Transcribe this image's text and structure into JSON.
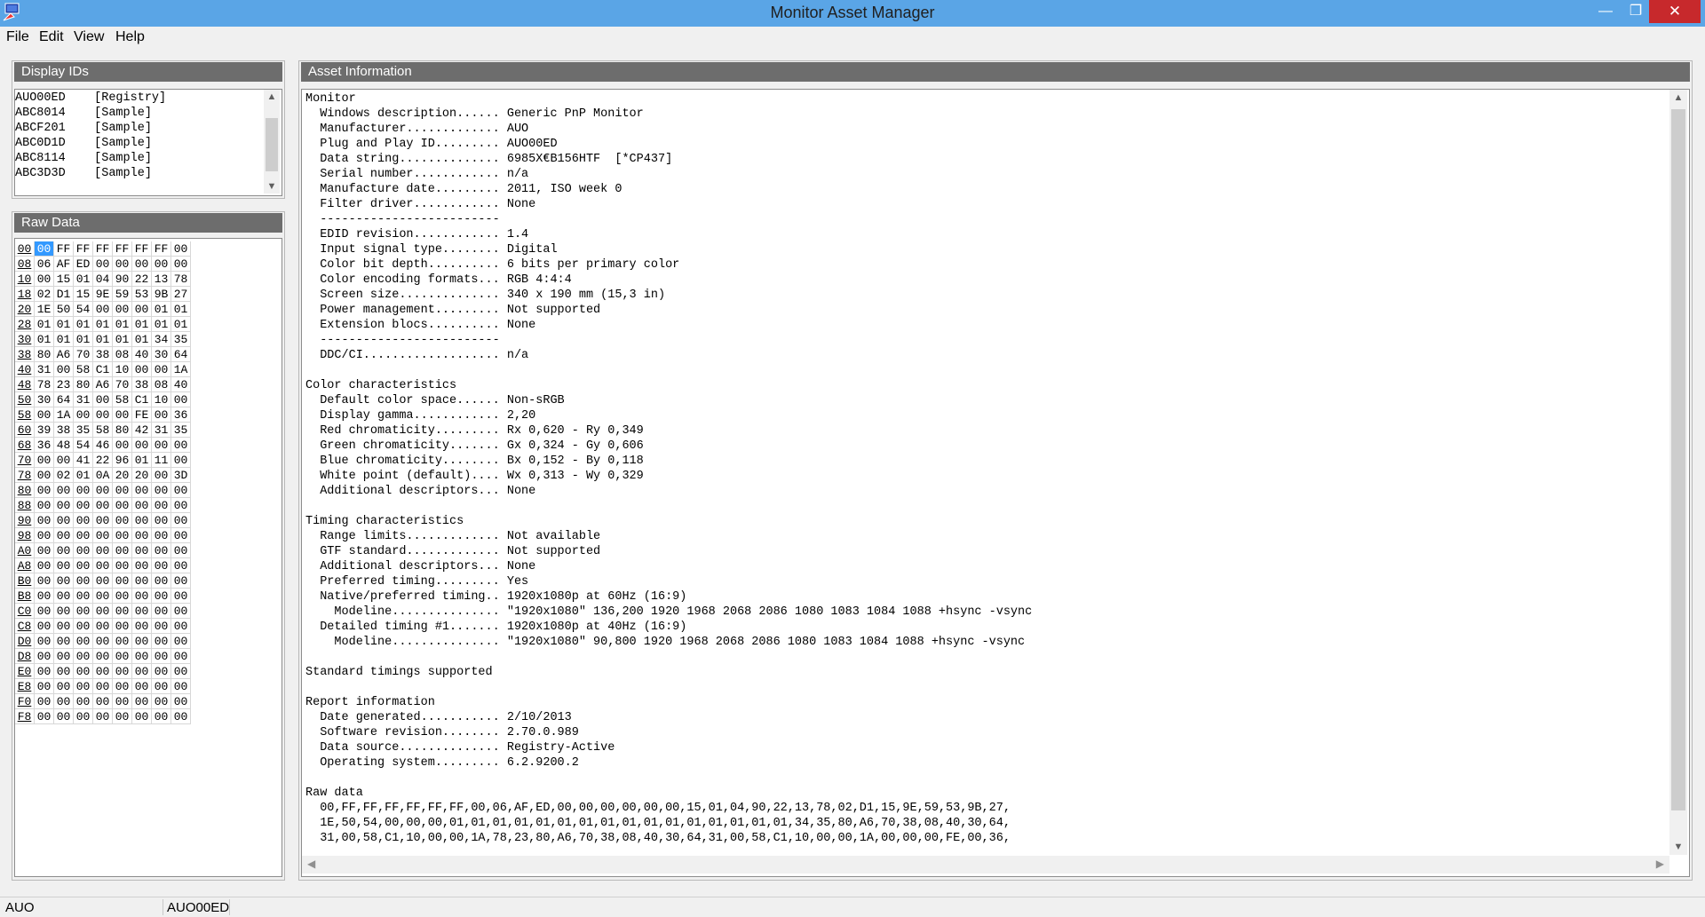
{
  "window": {
    "title": "Monitor Asset Manager",
    "minimize": "—",
    "maximize": "❐",
    "close": "✕"
  },
  "menu": [
    "File",
    "Edit",
    "View",
    "Help"
  ],
  "display_ids": {
    "header": "Display IDs",
    "items": [
      "AUO00ED    [Registry]",
      "ABC8014    [Sample]",
      "ABCF201    [Sample]",
      "ABC0D1D    [Sample]",
      "ABC8114    [Sample]",
      "ABC3D3D    [Sample]"
    ]
  },
  "raw_data": {
    "header": "Raw Data",
    "rows": [
      [
        "00",
        "00",
        "FF",
        "FF",
        "FF",
        "FF",
        "FF",
        "FF",
        "00"
      ],
      [
        "08",
        "06",
        "AF",
        "ED",
        "00",
        "00",
        "00",
        "00",
        "00"
      ],
      [
        "10",
        "00",
        "15",
        "01",
        "04",
        "90",
        "22",
        "13",
        "78"
      ],
      [
        "18",
        "02",
        "D1",
        "15",
        "9E",
        "59",
        "53",
        "9B",
        "27"
      ],
      [
        "20",
        "1E",
        "50",
        "54",
        "00",
        "00",
        "00",
        "01",
        "01"
      ],
      [
        "28",
        "01",
        "01",
        "01",
        "01",
        "01",
        "01",
        "01",
        "01"
      ],
      [
        "30",
        "01",
        "01",
        "01",
        "01",
        "01",
        "01",
        "34",
        "35"
      ],
      [
        "38",
        "80",
        "A6",
        "70",
        "38",
        "08",
        "40",
        "30",
        "64"
      ],
      [
        "40",
        "31",
        "00",
        "58",
        "C1",
        "10",
        "00",
        "00",
        "1A"
      ],
      [
        "48",
        "78",
        "23",
        "80",
        "A6",
        "70",
        "38",
        "08",
        "40"
      ],
      [
        "50",
        "30",
        "64",
        "31",
        "00",
        "58",
        "C1",
        "10",
        "00"
      ],
      [
        "58",
        "00",
        "1A",
        "00",
        "00",
        "00",
        "FE",
        "00",
        "36"
      ],
      [
        "60",
        "39",
        "38",
        "35",
        "58",
        "80",
        "42",
        "31",
        "35"
      ],
      [
        "68",
        "36",
        "48",
        "54",
        "46",
        "00",
        "00",
        "00",
        "00"
      ],
      [
        "70",
        "00",
        "00",
        "41",
        "22",
        "96",
        "01",
        "11",
        "00"
      ],
      [
        "78",
        "00",
        "02",
        "01",
        "0A",
        "20",
        "20",
        "00",
        "3D"
      ],
      [
        "80",
        "00",
        "00",
        "00",
        "00",
        "00",
        "00",
        "00",
        "00"
      ],
      [
        "88",
        "00",
        "00",
        "00",
        "00",
        "00",
        "00",
        "00",
        "00"
      ],
      [
        "90",
        "00",
        "00",
        "00",
        "00",
        "00",
        "00",
        "00",
        "00"
      ],
      [
        "98",
        "00",
        "00",
        "00",
        "00",
        "00",
        "00",
        "00",
        "00"
      ],
      [
        "A0",
        "00",
        "00",
        "00",
        "00",
        "00",
        "00",
        "00",
        "00"
      ],
      [
        "A8",
        "00",
        "00",
        "00",
        "00",
        "00",
        "00",
        "00",
        "00"
      ],
      [
        "B0",
        "00",
        "00",
        "00",
        "00",
        "00",
        "00",
        "00",
        "00"
      ],
      [
        "B8",
        "00",
        "00",
        "00",
        "00",
        "00",
        "00",
        "00",
        "00"
      ],
      [
        "C0",
        "00",
        "00",
        "00",
        "00",
        "00",
        "00",
        "00",
        "00"
      ],
      [
        "C8",
        "00",
        "00",
        "00",
        "00",
        "00",
        "00",
        "00",
        "00"
      ],
      [
        "D0",
        "00",
        "00",
        "00",
        "00",
        "00",
        "00",
        "00",
        "00"
      ],
      [
        "D8",
        "00",
        "00",
        "00",
        "00",
        "00",
        "00",
        "00",
        "00"
      ],
      [
        "E0",
        "00",
        "00",
        "00",
        "00",
        "00",
        "00",
        "00",
        "00"
      ],
      [
        "E8",
        "00",
        "00",
        "00",
        "00",
        "00",
        "00",
        "00",
        "00"
      ],
      [
        "F0",
        "00",
        "00",
        "00",
        "00",
        "00",
        "00",
        "00",
        "00"
      ],
      [
        "F8",
        "00",
        "00",
        "00",
        "00",
        "00",
        "00",
        "00",
        "00"
      ]
    ]
  },
  "asset": {
    "header": "Asset Information",
    "lines": [
      "Monitor",
      "  Windows description...... Generic PnP Monitor",
      "  Manufacturer............. AUO",
      "  Plug and Play ID......... AUO00ED",
      "  Data string.............. 6985X€B156HTF  [*CP437]",
      "  Serial number............ n/a",
      "  Manufacture date......... 2011, ISO week 0",
      "  Filter driver............ None",
      "  -------------------------",
      "  EDID revision............ 1.4",
      "  Input signal type........ Digital",
      "  Color bit depth.......... 6 bits per primary color",
      "  Color encoding formats... RGB 4:4:4",
      "  Screen size.............. 340 x 190 mm (15,3 in)",
      "  Power management......... Not supported",
      "  Extension blocs.......... None",
      "  -------------------------",
      "  DDC/CI................... n/a",
      "",
      "Color characteristics",
      "  Default color space...... Non-sRGB",
      "  Display gamma............ 2,20",
      "  Red chromaticity......... Rx 0,620 - Ry 0,349",
      "  Green chromaticity....... Gx 0,324 - Gy 0,606",
      "  Blue chromaticity........ Bx 0,152 - By 0,118",
      "  White point (default).... Wx 0,313 - Wy 0,329",
      "  Additional descriptors... None",
      "",
      "Timing characteristics",
      "  Range limits............. Not available",
      "  GTF standard............. Not supported",
      "  Additional descriptors... None",
      "  Preferred timing......... Yes",
      "  Native/preferred timing.. 1920x1080p at 60Hz (16:9)",
      "    Modeline............... \"1920x1080\" 136,200 1920 1968 2068 2086 1080 1083 1084 1088 +hsync -vsync",
      "  Detailed timing #1....... 1920x1080p at 40Hz (16:9)",
      "    Modeline............... \"1920x1080\" 90,800 1920 1968 2068 2086 1080 1083 1084 1088 +hsync -vsync",
      "",
      "Standard timings supported",
      "",
      "Report information",
      "  Date generated........... 2/10/2013",
      "  Software revision........ 2.70.0.989",
      "  Data source.............. Registry-Active",
      "  Operating system......... 6.2.9200.2",
      "",
      "Raw data",
      "  00,FF,FF,FF,FF,FF,FF,00,06,AF,ED,00,00,00,00,00,00,15,01,04,90,22,13,78,02,D1,15,9E,59,53,9B,27,",
      "  1E,50,54,00,00,00,01,01,01,01,01,01,01,01,01,01,01,01,01,01,01,01,34,35,80,A6,70,38,08,40,30,64,",
      "  31,00,58,C1,10,00,00,1A,78,23,80,A6,70,38,08,40,30,64,31,00,58,C1,10,00,00,1A,00,00,00,FE,00,36,"
    ]
  },
  "status": {
    "manufacturer": "AUO",
    "id": "AUO00ED"
  }
}
